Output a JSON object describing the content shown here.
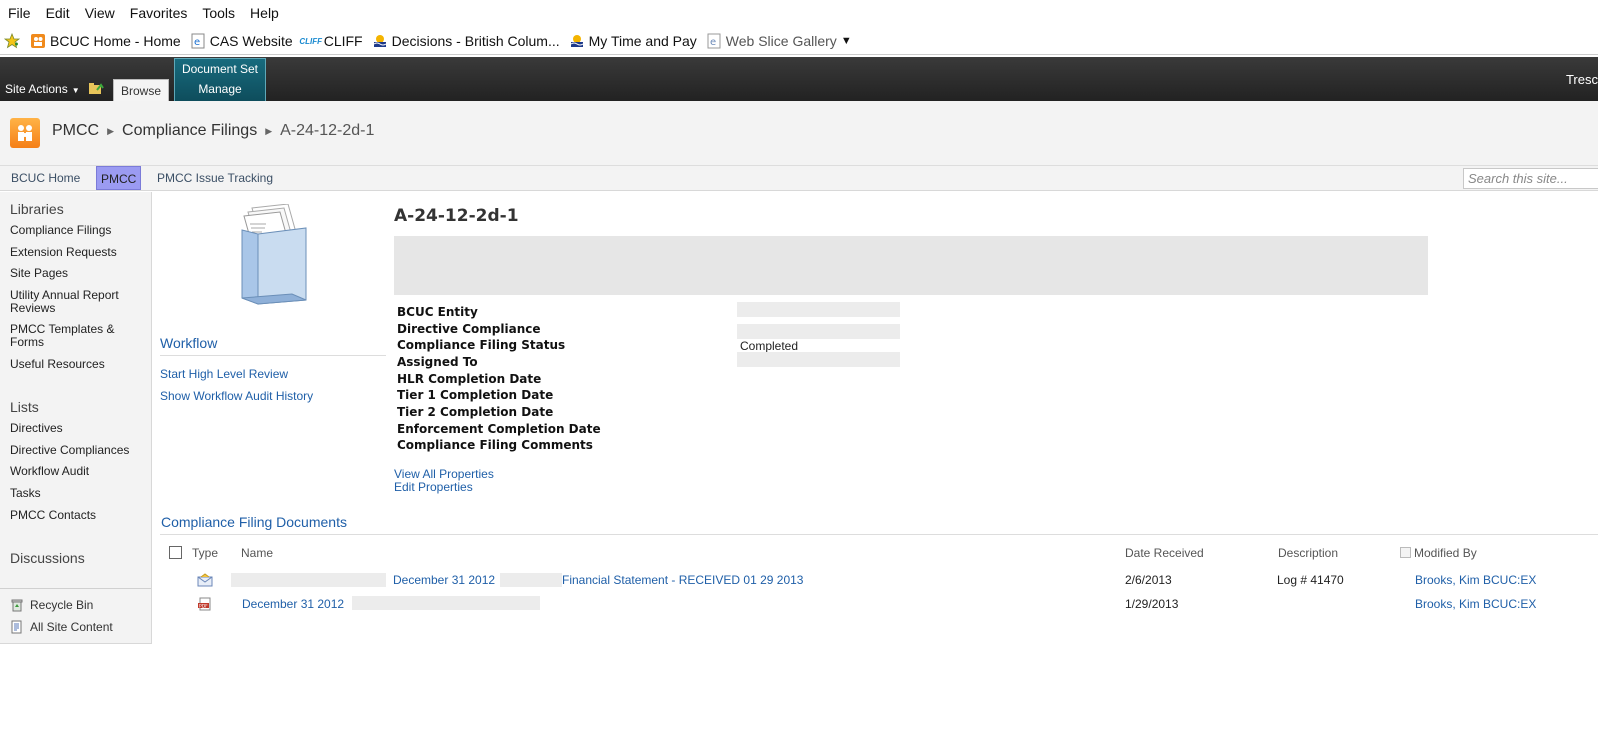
{
  "browser": {
    "menu": [
      "File",
      "Edit",
      "View",
      "Favorites",
      "Tools",
      "Help"
    ],
    "favorites": [
      {
        "label": "BCUC Home - Home",
        "icon": "sharepoint-icon"
      },
      {
        "label": "CAS Website",
        "icon": "ie-page-icon"
      },
      {
        "label": "CLIFF",
        "icon": "cliff-icon"
      },
      {
        "label": "Decisions - British Colum...",
        "icon": "bc-logo-icon"
      },
      {
        "label": "My Time and Pay",
        "icon": "bc-logo-icon"
      },
      {
        "label": "Web Slice Gallery",
        "icon": "web-slice-icon"
      }
    ]
  },
  "ribbon": {
    "site_actions": "Site Actions",
    "tab_browse": "Browse",
    "context_group": "Document Set",
    "context_tab": "Manage",
    "user": "Tresc"
  },
  "breadcrumb": {
    "site": "PMCC",
    "library": "Compliance Filings",
    "current": "A-24-12-2d-1"
  },
  "topnav": {
    "items": [
      "BCUC Home",
      "PMCC",
      "PMCC Issue Tracking"
    ],
    "selected": "PMCC",
    "search_placeholder": "Search this site..."
  },
  "leftnav": {
    "libraries_head": "Libraries",
    "libraries": [
      "Compliance Filings",
      "Extension Requests",
      "Site Pages",
      "Utility Annual Report Reviews",
      "PMCC Templates & Forms",
      "Useful Resources"
    ],
    "lists_head": "Lists",
    "lists": [
      "Directives",
      "Directive Compliances",
      "Workflow Audit",
      "Tasks",
      "PMCC Contacts"
    ],
    "discussions_head": "Discussions",
    "recycle_bin": "Recycle Bin",
    "all_site_content": "All Site Content"
  },
  "docset": {
    "title": "A-24-12-2d-1",
    "properties": [
      {
        "label": "BCUC Entity",
        "value": ""
      },
      {
        "label": "Directive Compliance",
        "value": ""
      },
      {
        "label": "Compliance Filing Status",
        "value": "Completed"
      },
      {
        "label": "Assigned To",
        "value": ""
      },
      {
        "label": "HLR Completion Date",
        "value": ""
      },
      {
        "label": "Tier 1 Completion Date",
        "value": ""
      },
      {
        "label": "Tier 2 Completion Date",
        "value": ""
      },
      {
        "label": "Enforcement Completion Date",
        "value": ""
      },
      {
        "label": "Compliance Filing Comments",
        "value": ""
      }
    ],
    "view_all": "View All Properties",
    "edit": "Edit Properties"
  },
  "workflow": {
    "head": "Workflow",
    "start": "Start High Level Review",
    "history": "Show Workflow Audit History"
  },
  "documents": {
    "head": "Compliance Filing Documents",
    "columns": {
      "type": "Type",
      "name": "Name",
      "date_received": "Date Received",
      "description": "Description",
      "modified_by": "Modified By"
    },
    "rows": [
      {
        "type_icon": "email-icon",
        "name_part1": "December 31 2012",
        "name_part2": "Financial Statement - RECEIVED 01 29 2013",
        "date_received": "2/6/2013",
        "description": "Log # 41470",
        "modified_by": "Brooks, Kim BCUC:EX"
      },
      {
        "type_icon": "pdf-icon",
        "name_part1": "December 31 2012",
        "name_part2": "",
        "date_received": "1/29/2013",
        "description": "",
        "modified_by": "Brooks, Kim BCUC:EX"
      }
    ]
  },
  "colors": {
    "ribbon_dark": "#2b2b2b",
    "context_tab": "#186b7e",
    "link_blue": "#1f5fa8",
    "selected_nav": "#9b9bf2",
    "logo_orange": "#f57f17"
  }
}
